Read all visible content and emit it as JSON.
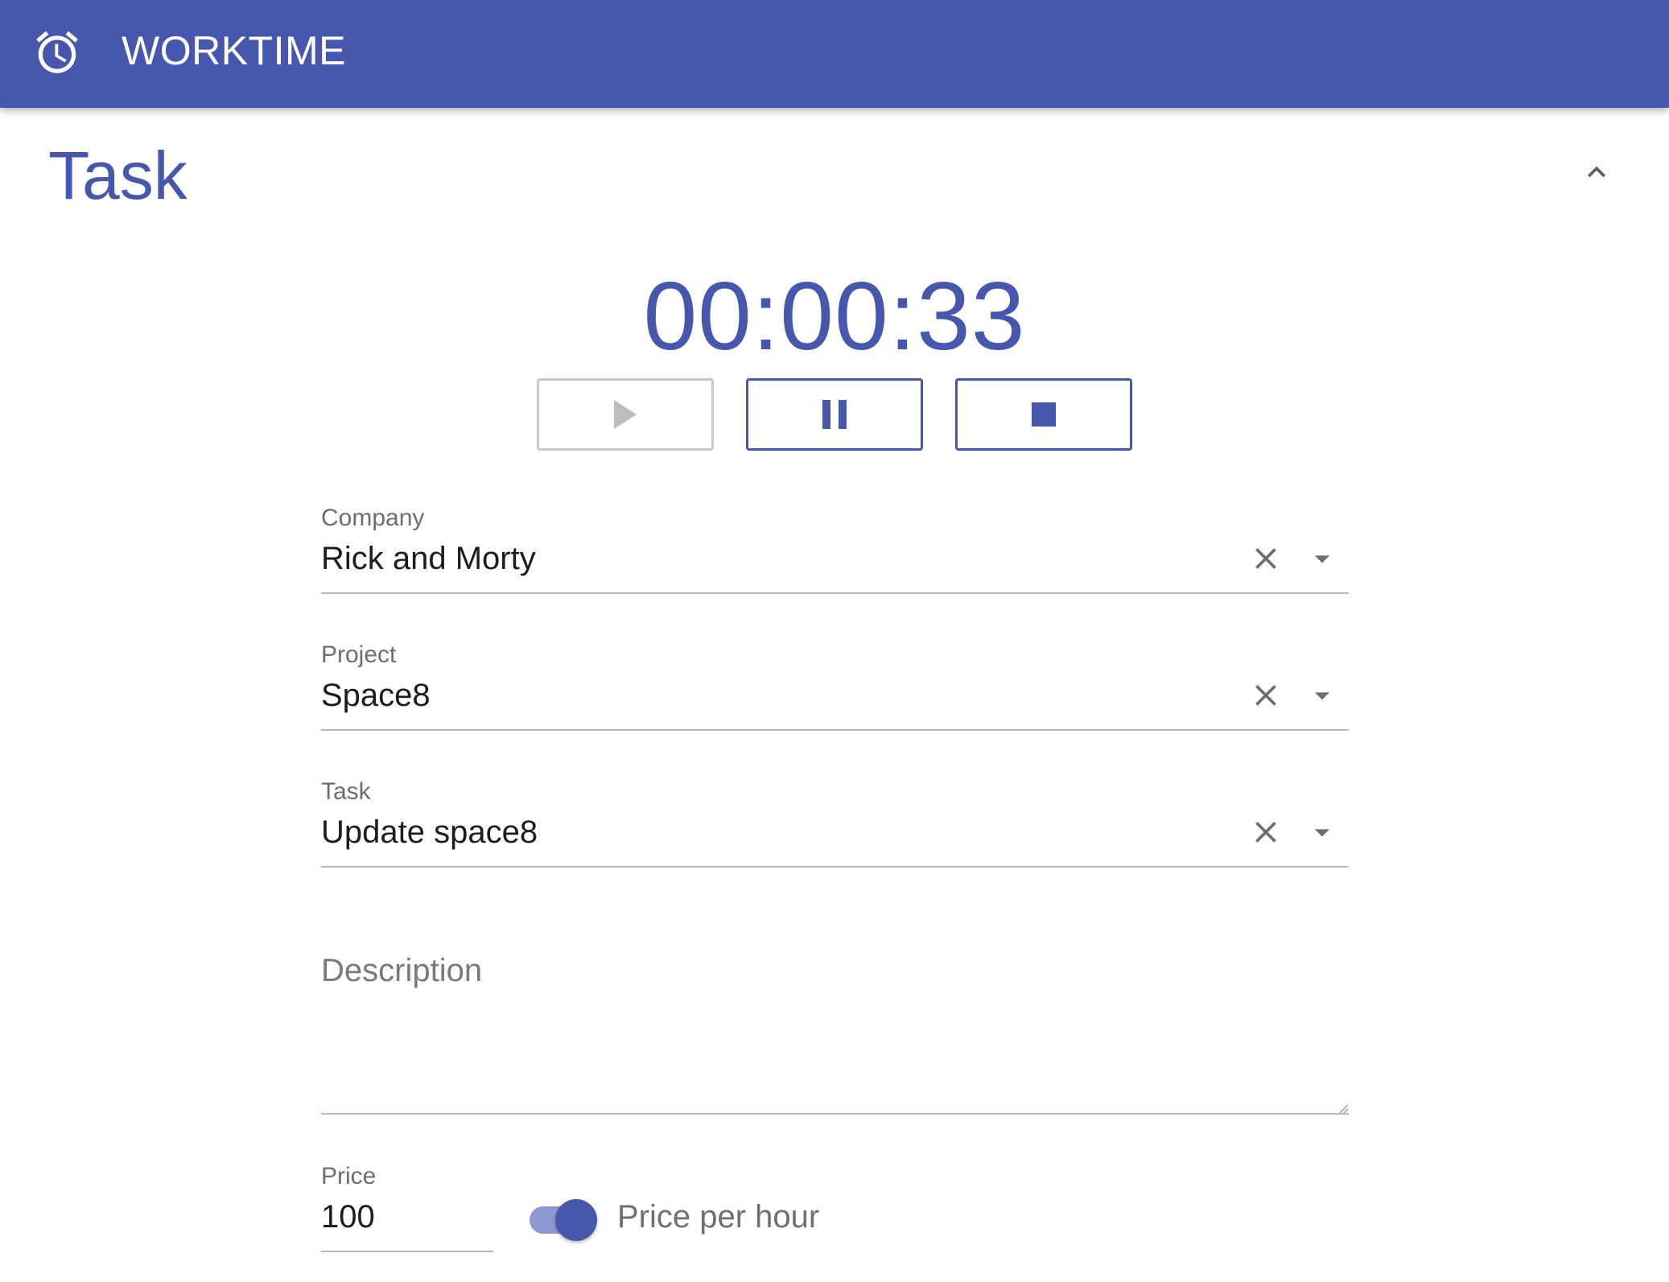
{
  "app_bar": {
    "icon": "alarm-clock-icon",
    "title": "WORKTIME"
  },
  "section": {
    "title": "Task",
    "collapse_icon": "chevron-up-icon"
  },
  "timer": {
    "display": "00:00:33"
  },
  "controls": {
    "play": {
      "icon": "play-icon",
      "enabled": false
    },
    "pause": {
      "icon": "pause-icon",
      "enabled": true
    },
    "stop": {
      "icon": "stop-icon",
      "enabled": true
    }
  },
  "form": {
    "company": {
      "label": "Company",
      "value": "Rick and Morty"
    },
    "project": {
      "label": "Project",
      "value": "Space8"
    },
    "task": {
      "label": "Task",
      "value": "Update space8"
    },
    "description": {
      "placeholder": "Description",
      "value": ""
    },
    "price": {
      "label": "Price",
      "value": "100"
    },
    "price_per_hour": {
      "label": "Price per hour",
      "checked": true
    }
  },
  "colors": {
    "primary": "#4757ad",
    "primary_light": "#8f98d4",
    "disabled": "#c8c8c8",
    "text": "#1d1d1d",
    "muted": "#6e6e6e"
  }
}
